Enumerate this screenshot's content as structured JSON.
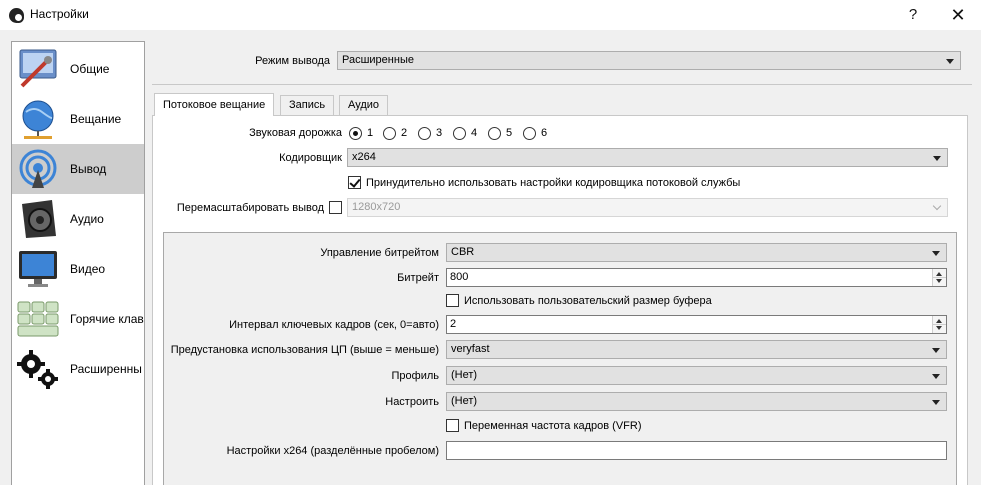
{
  "window": {
    "title": "Настройки",
    "help_label": "?",
    "close_label": "✕"
  },
  "sidebar": {
    "items": [
      {
        "label": "Общие",
        "icon": "general-settings-icon",
        "selected": false
      },
      {
        "label": "Вещание",
        "icon": "broadcast-globe-icon",
        "selected": false
      },
      {
        "label": "Вывод",
        "icon": "output-signal-icon",
        "selected": true
      },
      {
        "label": "Аудио",
        "icon": "speaker-icon",
        "selected": false
      },
      {
        "label": "Видео",
        "icon": "monitor-icon",
        "selected": false
      },
      {
        "label": "Горячие клав",
        "icon": "keyboard-icon",
        "selected": false
      },
      {
        "label": "Расширенны",
        "icon": "gears-icon",
        "selected": false
      }
    ]
  },
  "output_mode": {
    "label": "Режим вывода",
    "value": "Расширенные"
  },
  "tabs": [
    {
      "label": "Потоковое вещание",
      "active": true
    },
    {
      "label": "Запись",
      "active": false
    },
    {
      "label": "Аудио",
      "active": false
    }
  ],
  "streaming": {
    "audio_track": {
      "label": "Звуковая дорожка",
      "options": [
        "1",
        "2",
        "3",
        "4",
        "5",
        "6"
      ],
      "selected": "1"
    },
    "encoder": {
      "label": "Кодировщик",
      "value": "x264"
    },
    "enforce_encoder": {
      "label": "Принудительно использовать настройки кодировщика потоковой службы",
      "checked": true
    },
    "rescale": {
      "label": "Перемасштабировать вывод",
      "checked": false,
      "value": "1280x720"
    },
    "rate_control": {
      "label": "Управление битрейтом",
      "value": "CBR"
    },
    "bitrate": {
      "label": "Битрейт",
      "value": "800"
    },
    "custom_buffer": {
      "label": "Использовать пользовательский размер буфера",
      "checked": false
    },
    "keyframe_interval": {
      "label": "Интервал ключевых кадров (сек, 0=авто)",
      "value": "2"
    },
    "cpu_preset": {
      "label": "Предустановка использования ЦП (выше = меньше)",
      "value": "veryfast"
    },
    "profile": {
      "label": "Профиль",
      "value": "(Нет)"
    },
    "tune": {
      "label": "Настроить",
      "value": "(Нет)"
    },
    "vfr": {
      "label": "Переменная частота кадров (VFR)",
      "checked": false
    },
    "x264_options": {
      "label": "Настройки x264 (разделённые пробелом)",
      "value": ""
    }
  }
}
